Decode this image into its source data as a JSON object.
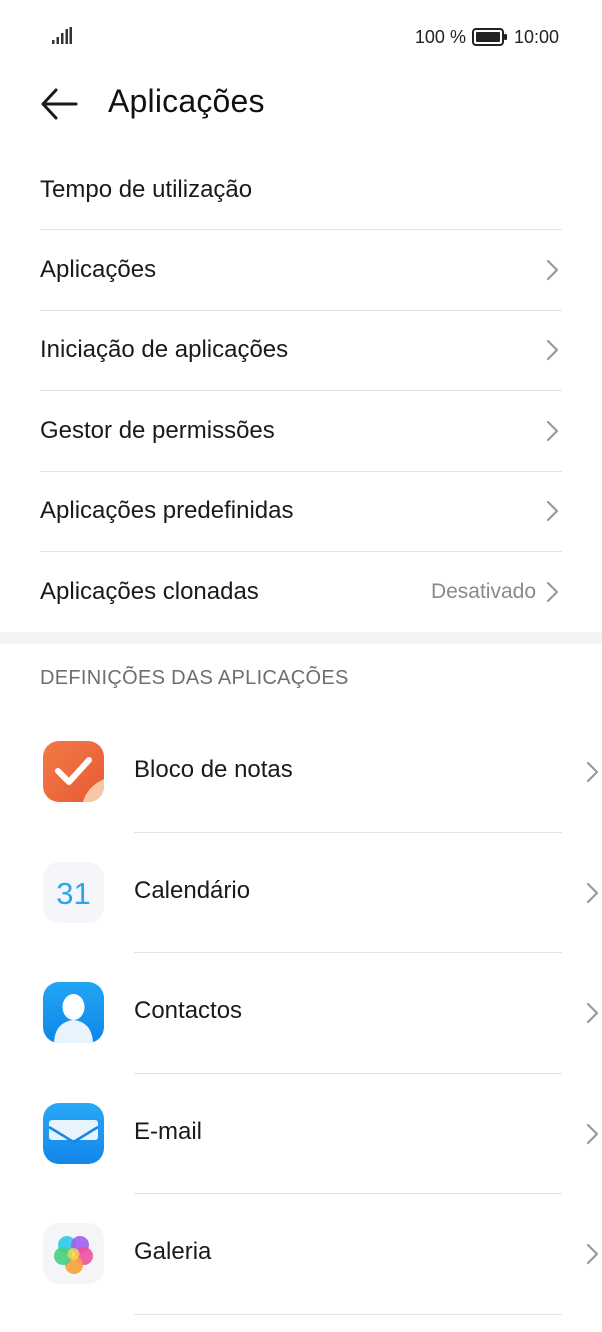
{
  "status_bar": {
    "battery_percent": "100 %",
    "time": "10:00",
    "icons": [
      "signal-icon",
      "battery-icon"
    ]
  },
  "header": {
    "title": "Aplicações",
    "back_icon": "arrow-left-icon"
  },
  "menu": [
    {
      "label": "Tempo de utilização"
    },
    {
      "label": "Aplicações"
    },
    {
      "label": "Iniciação de aplicações"
    },
    {
      "label": "Gestor de permissões"
    },
    {
      "label": "Aplicações predefinidas"
    },
    {
      "label": "Aplicações clonadas",
      "value": "Desativado"
    }
  ],
  "section": {
    "title": "DEFINIÇÕES DAS APLICAÇÕES"
  },
  "apps": [
    {
      "label": "Bloco de notas",
      "icon": "notepad-icon"
    },
    {
      "label": "Calendário",
      "icon": "calendar-icon",
      "icon_text": "31"
    },
    {
      "label": "Contactos",
      "icon": "contacts-icon"
    },
    {
      "label": "E-mail",
      "icon": "email-icon"
    },
    {
      "label": "Galeria",
      "icon": "gallery-icon"
    }
  ],
  "colors": {
    "divider": "#e3e3e3",
    "secondary_text": "#8a8a8a",
    "section_band": "#f3f3f3",
    "notepad": "#ee6a3f",
    "calendar_text": "#2aa7e8",
    "contacts": "#1a9af0",
    "email": "#1e90f0"
  }
}
